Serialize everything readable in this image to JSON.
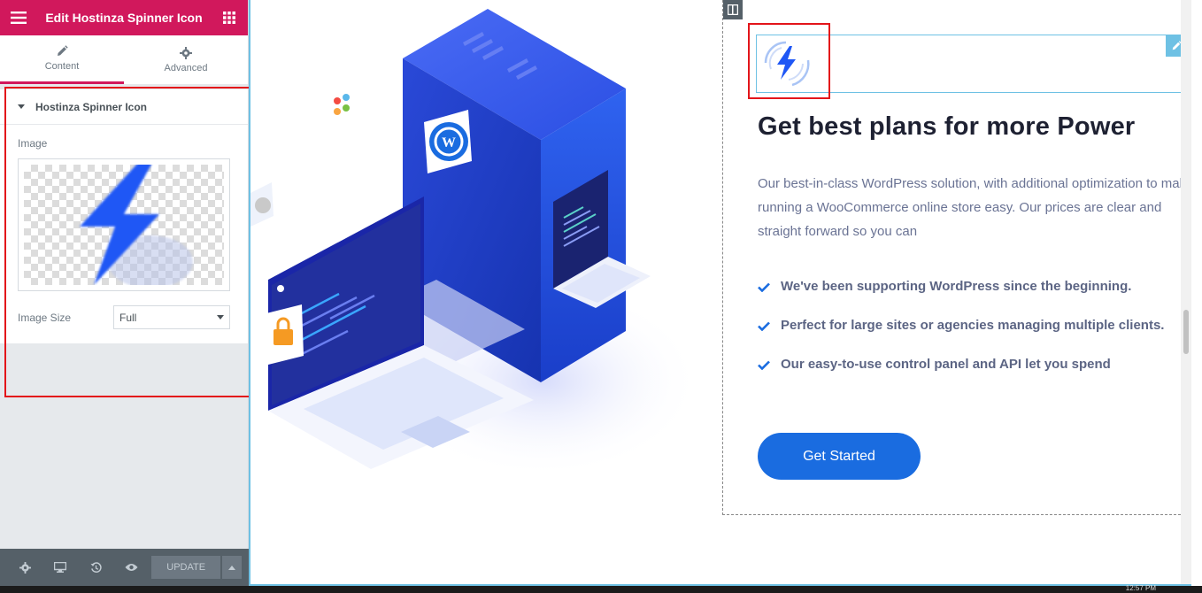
{
  "panel": {
    "title": "Edit Hostinza Spinner Icon",
    "tabs": [
      {
        "label": "Content",
        "icon": "pencil-icon",
        "active": true
      },
      {
        "label": "Advanced",
        "icon": "gear-icon",
        "active": false
      }
    ],
    "section": {
      "title": "Hostinza Spinner Icon",
      "image_label": "Image",
      "image_size_label": "Image Size",
      "image_size_value": "Full"
    },
    "footer": {
      "update_label": "UPDATE"
    }
  },
  "preview": {
    "heading": "Get best plans for more Power",
    "paragraph": "Our best-in-class WordPress solution, with additional optimization to make running a WooCommerce online store easy. Our prices are clear and straight forward so you can",
    "features": [
      "We've been supporting WordPress since the beginning.",
      "Perfect for large sites or agencies managing multiple clients.",
      "Our easy-to-use control panel and API let you spend"
    ],
    "cta_label": "Get Started"
  },
  "taskbar": {
    "clock": "12:57 PM"
  },
  "colors": {
    "elementor_pink": "#d1185c",
    "accent_blue": "#1a6ce0",
    "highlight_red": "#e3151a",
    "edit_blue": "#6ec1e4"
  }
}
